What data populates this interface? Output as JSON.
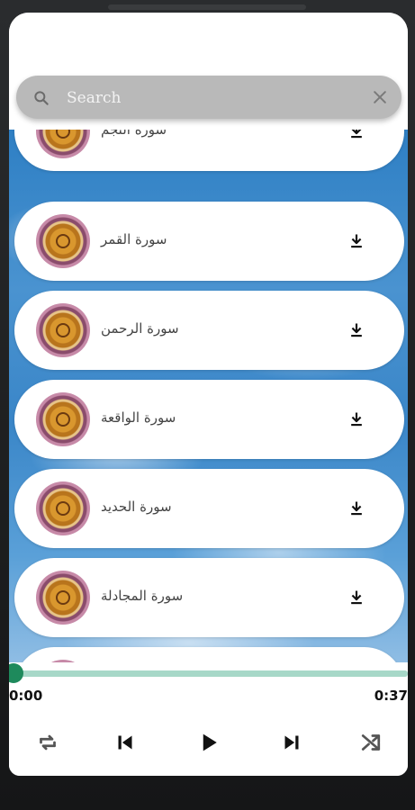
{
  "search": {
    "placeholder": "Search"
  },
  "surahs": [
    {
      "name": "سورة النجم"
    },
    {
      "name": "سورة القمر"
    },
    {
      "name": "سورة الرحمن"
    },
    {
      "name": "سورة الواقعة"
    },
    {
      "name": "سورة الحديد"
    },
    {
      "name": "سورة المجادلة"
    },
    {
      "name": ""
    }
  ],
  "player": {
    "current_time": "0:00",
    "total_time": "0:37",
    "progress": 0.0
  },
  "icons": {
    "search": "search-icon",
    "clear": "close-icon",
    "download": "download-icon",
    "repeat": "repeat-icon",
    "previous": "skip-previous-icon",
    "play": "play-icon",
    "next": "skip-next-icon",
    "shuffle": "shuffle-icon"
  },
  "colors": {
    "progress_track": "#a7d8c8",
    "progress_thumb": "#1e8a5c",
    "search_bar": "#b9b9b9"
  }
}
